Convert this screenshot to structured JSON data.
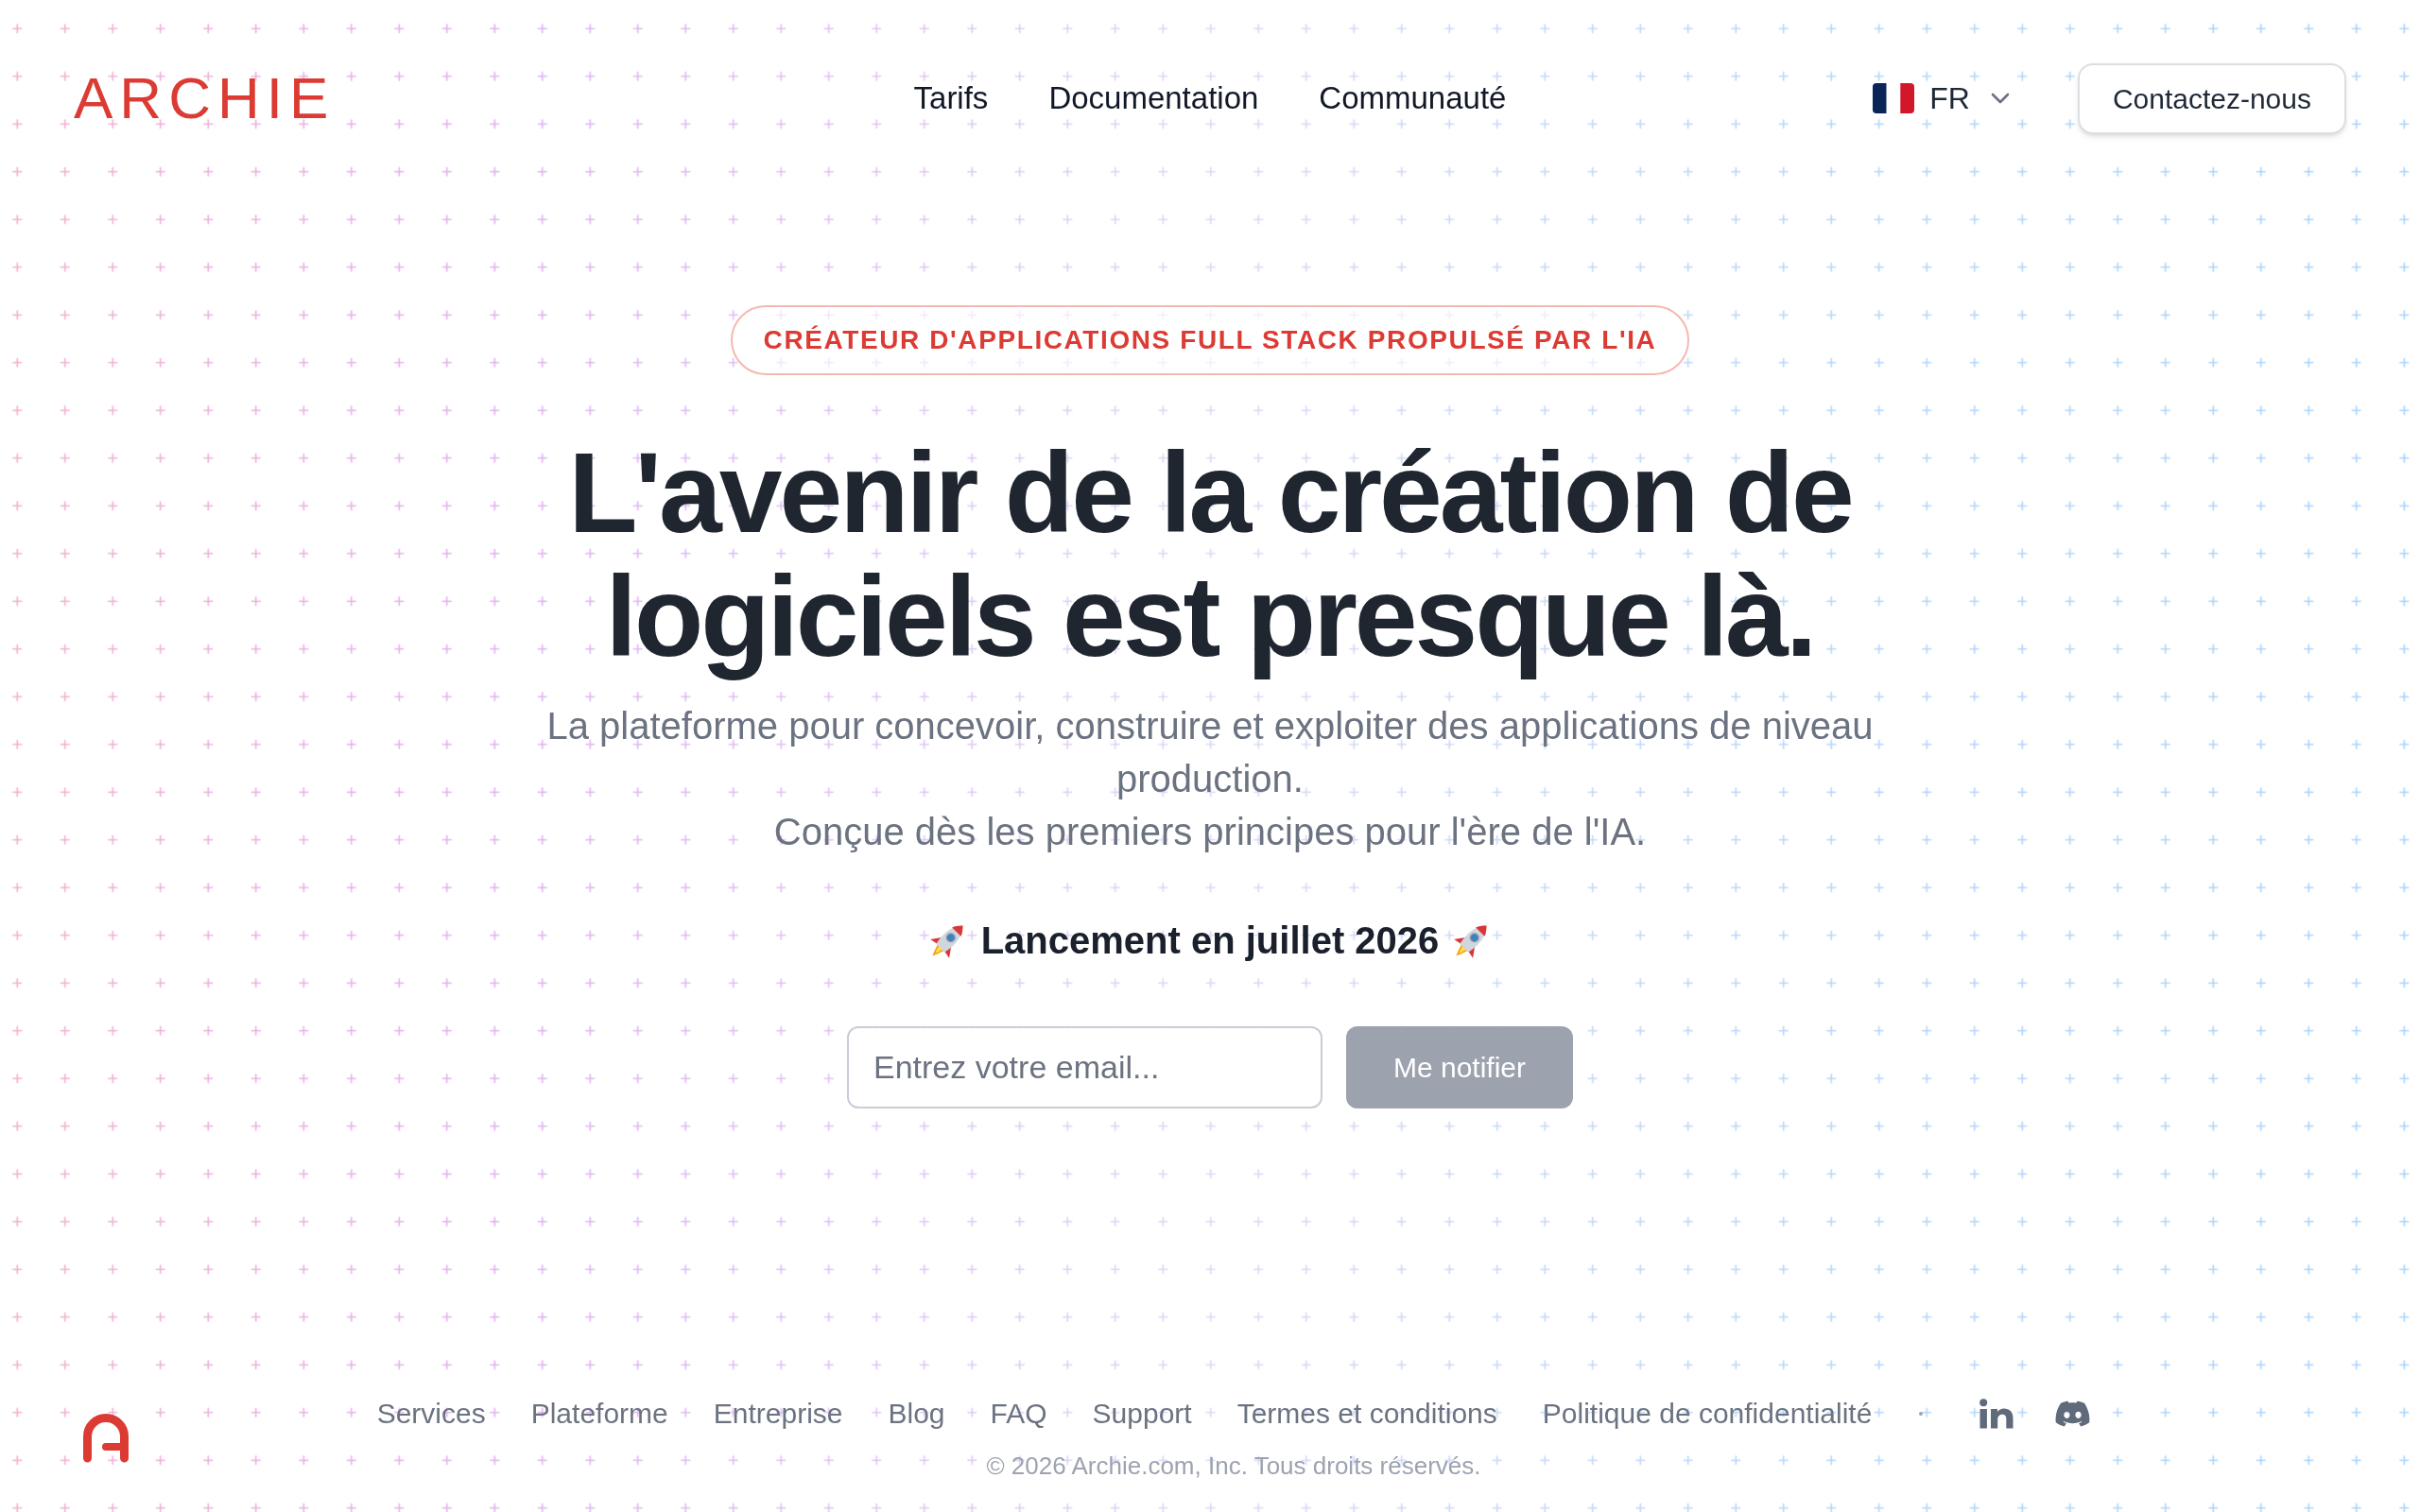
{
  "header": {
    "logo": "ARCHIE",
    "nav": [
      "Tarifs",
      "Documentation",
      "Communauté"
    ],
    "language": {
      "code": "FR"
    },
    "contact_button": "Contactez-nous"
  },
  "hero": {
    "badge": "CRÉATEUR D'APPLICATIONS FULL STACK PROPULSÉ PAR L'IA",
    "headline": "L'avenir de la création de logiciels est presque là.",
    "subtitle": [
      "La plateforme pour concevoir, construire et exploiter des applications de niveau production.",
      "Conçue dès les premiers principes pour l'ère de l'IA."
    ],
    "launch": "Lancement en juillet 2026",
    "signup": {
      "email": {
        "placeholder": "Entrez votre email..."
      },
      "button": {
        "label": "Me notifier",
        "disabled": true
      }
    }
  },
  "footer": {
    "links": [
      "Services",
      "Plateforme",
      "Entreprise",
      "Blog",
      "FAQ",
      "Support",
      "Termes et conditions",
      "Politique de confidentialité"
    ],
    "copyright": "© 2026 Archie.com, Inc. Tous droits réservés."
  }
}
